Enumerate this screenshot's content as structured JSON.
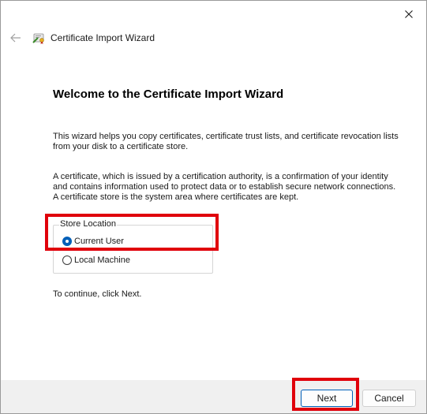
{
  "window": {
    "title": "Certificate Import Wizard"
  },
  "icons": {
    "close": "close-icon",
    "back": "back-arrow-icon",
    "wizard": "certificate-wizard-icon"
  },
  "content": {
    "heading": "Welcome to the Certificate Import Wizard",
    "paragraph1": "This wizard helps you copy certificates, certificate trust lists, and certificate revocation lists from your disk to a certificate store.",
    "paragraph2": "A certificate, which is issued by a certification authority, is a confirmation of your identity and contains information used to protect data or to establish secure network connections. A certificate store is the system area where certificates are kept.",
    "continue_text": "To continue, click Next."
  },
  "store_location": {
    "legend": "Store Location",
    "options": [
      {
        "label": "Current User",
        "selected": true
      },
      {
        "label": "Local Machine",
        "selected": false
      }
    ]
  },
  "footer": {
    "next_label": "Next",
    "cancel_label": "Cancel"
  },
  "colors": {
    "accent": "#005fb8",
    "highlight": "#e0000b",
    "footer_bg": "#f0f0f0"
  }
}
